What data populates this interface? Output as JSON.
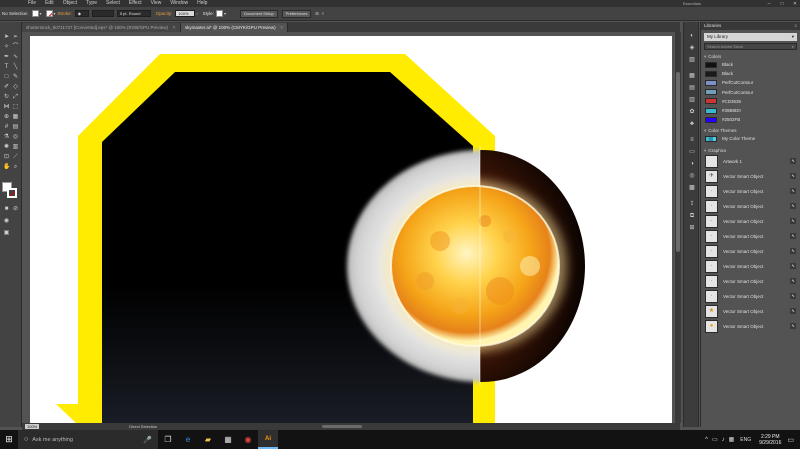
{
  "menubar": {
    "items": [
      "File",
      "Edit",
      "Object",
      "Type",
      "Select",
      "Effect",
      "View",
      "Window",
      "Help"
    ],
    "workspace": "Essentials",
    "win_min": "–",
    "win_max": "□",
    "win_close": "✕"
  },
  "controlbar": {
    "tool_name": "No Selection",
    "stroke_label": "Stroke:",
    "stroke_arrows": "◆",
    "brush_value": "5 pt. Round",
    "opacity_label": "Opacity:",
    "opacity_value": "100%",
    "style_label": "Style:",
    "document_setup": "Document Setup",
    "preferences": "Preferences"
  },
  "tabs": [
    {
      "label": "shutterstock_80711737 [Converted].eps* @ 100% (RGB/GPU Preview)",
      "close": "✕"
    },
    {
      "label": "skymaster.ai* @ 100% (CMYK/GPU Preview)",
      "close": "✕"
    }
  ],
  "statusbar": {
    "zoom": "100%",
    "tool": "Direct Selection"
  },
  "libraries": {
    "panel_title": "Libraries",
    "panel_menu": "≡",
    "library_name": "My Library",
    "search_placeholder": "Search Adobe Stock",
    "colors_heading": "Colors",
    "colors": [
      {
        "name": "Black",
        "hex": "#111111"
      },
      {
        "name": "Black",
        "hex": "#1a1a1a"
      },
      {
        "name": "PerfCutContour",
        "hex": "#7f8fc9"
      },
      {
        "name": "PerfCutContour",
        "hex": "#6f9fb9"
      },
      {
        "name": "#CD3535",
        "hex": "#CD3535"
      },
      {
        "name": "#39B8D0",
        "hex": "#39B8D0"
      },
      {
        "name": "#2502FB",
        "hex": "#2502FB"
      }
    ],
    "themes_heading": "Color Themes",
    "themes": [
      {
        "name": "My Color Theme",
        "hex": [
          "#39B8D0",
          "#2a8fb0",
          "#5cc8dd"
        ]
      }
    ],
    "graphics_heading": "Graphics",
    "graphics": [
      {
        "name": "Artwork 1",
        "icon": ""
      },
      {
        "name": "Vector Smart Object",
        "icon": "✈"
      },
      {
        "name": "Vector Smart Object",
        "icon": "·"
      },
      {
        "name": "Vector Smart Object",
        "icon": "·"
      },
      {
        "name": "Vector Smart Object",
        "icon": "·"
      },
      {
        "name": "Vector Smart Object",
        "icon": "·"
      },
      {
        "name": "Vector Smart Object",
        "icon": "·"
      },
      {
        "name": "Vector Smart Object",
        "icon": "·"
      },
      {
        "name": "Vector Smart Object",
        "icon": "·"
      },
      {
        "name": "Vector Smart Object",
        "icon": "·"
      },
      {
        "name": "Vector Smart Object",
        "icon": "★"
      },
      {
        "name": "Vector Smart Object",
        "icon": "●"
      }
    ],
    "badge_glyph": "⬉"
  },
  "taskbar": {
    "start_glyph": "⊞",
    "search_placeholder": "Ask me anything",
    "search_icon": "○",
    "mic_icon": "🎤",
    "apps": [
      {
        "name": "task-view-icon",
        "glyph": "❐"
      },
      {
        "name": "edge-icon",
        "glyph": "e"
      },
      {
        "name": "file-explorer-icon",
        "glyph": "▰"
      },
      {
        "name": "store-icon",
        "glyph": "▦"
      },
      {
        "name": "chrome-icon",
        "glyph": "◉"
      },
      {
        "name": "illustrator-icon",
        "glyph": "Ai"
      }
    ],
    "tray_icons": [
      "^",
      "▭",
      "♪",
      "▦"
    ],
    "language": "ENG",
    "time": "2:29 PM",
    "date": "9/29/2016",
    "notification_glyph": "▭"
  },
  "colors": {
    "accent_yellow": "#FFEC00",
    "artboard_black": "#000000"
  }
}
